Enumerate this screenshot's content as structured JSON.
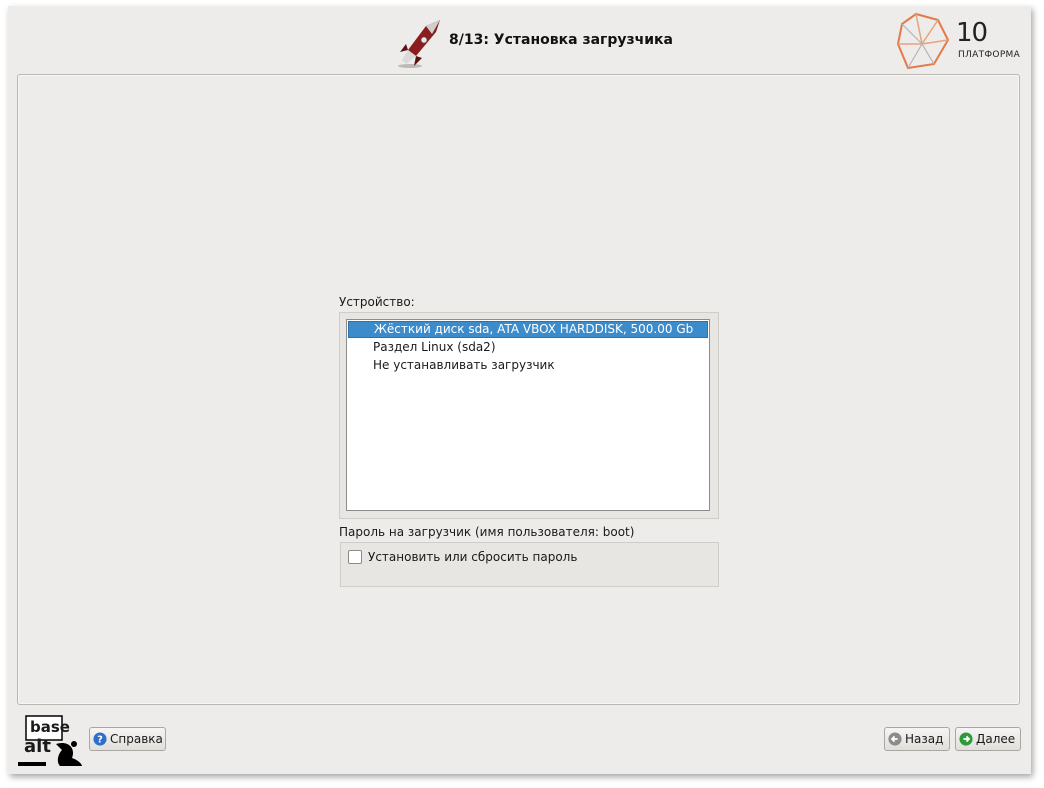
{
  "header": {
    "title": "8/13: Установка загрузчика",
    "platform_number": "10",
    "platform_label": "ПЛАТФОРМА"
  },
  "device": {
    "label": "Устройство:",
    "items": [
      {
        "label": "Жёсткий диск sda, ATA VBOX HARDDISK, 500.00 Gb",
        "selected": true
      },
      {
        "label": "Раздел Linux (sda2)",
        "selected": false
      },
      {
        "label": "Не устанавливать загрузчик",
        "selected": false
      }
    ]
  },
  "password": {
    "label": "Пароль на загрузчик (имя пользователя: boot)",
    "checkbox_label": "Установить или сбросить пароль",
    "checked": false
  },
  "footer": {
    "basealt_top": "base",
    "basealt_bottom": "alt",
    "help_label": "Справка",
    "back_label": "Назад",
    "next_label": "Далее"
  },
  "colors": {
    "selection": "#3c8bcb",
    "background": "#edecea",
    "help_icon": "#2f6fc9",
    "nav_icon": "#2e9a3a"
  }
}
